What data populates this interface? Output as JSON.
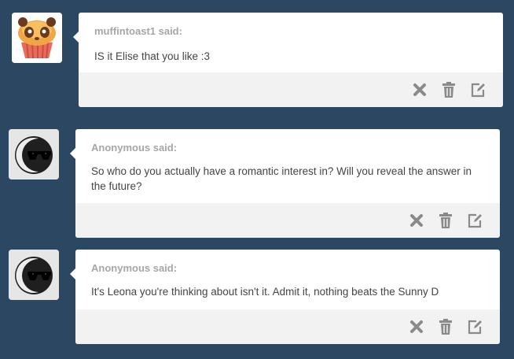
{
  "posts": [
    {
      "asker": "muffintoast1 said:",
      "message": "IS it Elise that you like :3",
      "avatar_icon": "muffin-panda-avatar-icon"
    },
    {
      "asker": "Anonymous said:",
      "message": "So who do you actually have a romantic interest in? Will you reveal the answer in the future?",
      "avatar_icon": "anonymous-sunglasses-avatar-icon"
    },
    {
      "asker": "Anonymous said:",
      "message": "It's Leona you're thinking about isn't it. Admit it, nothing beats the Sunny D",
      "avatar_icon": "anonymous-sunglasses-avatar-icon"
    }
  ],
  "actions": {
    "delete_icon": "x-icon",
    "trash_icon": "trash-icon",
    "edit_icon": "edit-icon"
  },
  "colors": {
    "background": "#2c4762",
    "card": "#ffffff",
    "footer": "#f2f2f2",
    "asker_text": "#a6a6a6",
    "message_text": "#444444",
    "icon": "#8a8a8a"
  }
}
